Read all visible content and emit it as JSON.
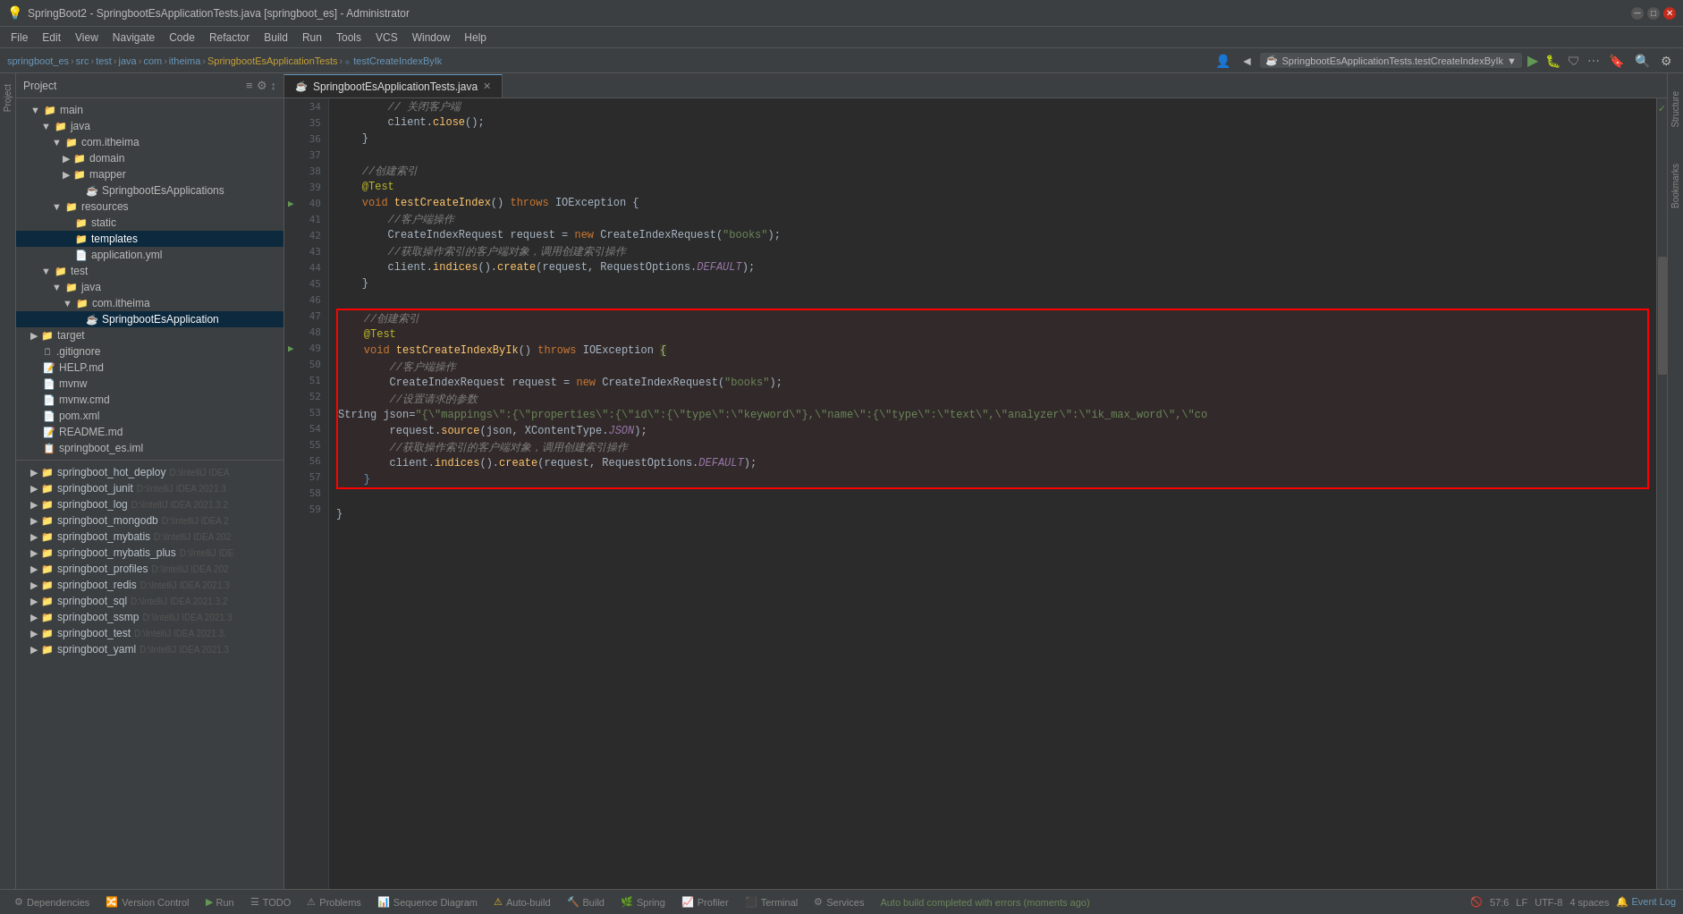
{
  "titleBar": {
    "title": "SpringBoot2 - SpringbootEsApplicationTests.java [springboot_es] - Administrator",
    "minimize": "─",
    "maximize": "□",
    "close": "✕"
  },
  "menuBar": {
    "items": [
      "File",
      "Edit",
      "View",
      "Navigate",
      "Code",
      "Refactor",
      "Build",
      "Run",
      "Tools",
      "VCS",
      "Window",
      "Help"
    ]
  },
  "breadcrumb": {
    "items": [
      "springboot_es",
      "src",
      "test",
      "java",
      "com",
      "itheima",
      "SpringbootEsApplicationTests",
      "testCreateIndexByIk"
    ]
  },
  "runConfig": {
    "label": "SpringbootEsApplicationTests.testCreateIndexByIk"
  },
  "sidebar": {
    "title": "Project",
    "tree": [
      {
        "indent": 2,
        "type": "folder",
        "label": "main",
        "expanded": true
      },
      {
        "indent": 3,
        "type": "folder",
        "label": "java",
        "expanded": true
      },
      {
        "indent": 4,
        "type": "folder",
        "label": "com.itheima",
        "expanded": true
      },
      {
        "indent": 5,
        "type": "folder",
        "label": "domain",
        "collapsed": true
      },
      {
        "indent": 5,
        "type": "folder",
        "label": "mapper",
        "collapsed": true
      },
      {
        "indent": 5,
        "type": "java",
        "label": "SpringbootEsApplications",
        "selected": false
      },
      {
        "indent": 4,
        "type": "folder",
        "label": "resources",
        "expanded": true
      },
      {
        "indent": 5,
        "type": "folder",
        "label": "static",
        "collapsed": true
      },
      {
        "indent": 5,
        "type": "folder-tpl",
        "label": "templates",
        "selected": true
      },
      {
        "indent": 5,
        "type": "yaml",
        "label": "application.yml"
      },
      {
        "indent": 3,
        "type": "folder",
        "label": "test",
        "expanded": true
      },
      {
        "indent": 4,
        "type": "folder",
        "label": "java",
        "expanded": true
      },
      {
        "indent": 5,
        "type": "folder",
        "label": "com.itheima",
        "expanded": true
      },
      {
        "indent": 6,
        "type": "test-java",
        "label": "SpringbootEsApplication",
        "selected": true
      },
      {
        "indent": 2,
        "type": "folder-target",
        "label": "target",
        "collapsed": true
      },
      {
        "indent": 2,
        "type": "gitignore",
        "label": ".gitignore"
      },
      {
        "indent": 2,
        "type": "md",
        "label": "HELP.md"
      },
      {
        "indent": 2,
        "type": "file",
        "label": "mvnw"
      },
      {
        "indent": 2,
        "type": "file",
        "label": "mvnw.cmd"
      },
      {
        "indent": 2,
        "type": "xml",
        "label": "pom.xml"
      },
      {
        "indent": 2,
        "type": "md",
        "label": "README.md"
      },
      {
        "indent": 2,
        "type": "iml",
        "label": "springboot_es.iml"
      }
    ],
    "externalProjects": [
      {
        "label": "springboot_hot_deploy",
        "path": "D:\\IntelliJ IDEA"
      },
      {
        "label": "springboot_junit",
        "path": "D:\\IntelliJ IDEA 2021.3"
      },
      {
        "label": "springboot_log",
        "path": "D:\\IntelliJ IDEA 2021.3.2"
      },
      {
        "label": "springboot_mongodb",
        "path": "D:\\IntelliJ IDEA 2"
      },
      {
        "label": "springboot_mybatis",
        "path": "D:\\IntelliJ IDEA 202"
      },
      {
        "label": "springboot_mybatis_plus",
        "path": "D:\\IntelliJ IDE"
      },
      {
        "label": "springboot_profiles",
        "path": "D:\\IntelliJ IDEA 2021"
      },
      {
        "label": "springboot_redis",
        "path": "D:\\IntelliJ IDEA 2021.3"
      },
      {
        "label": "springboot_sql",
        "path": "D:\\IntelliJ IDEA 2021.3.2"
      },
      {
        "label": "springboot_ssmp",
        "path": "D:\\IntelliJ IDEA 2021.3"
      },
      {
        "label": "springboot_test",
        "path": "D:\\IntelliJ IDEA 2021.3."
      },
      {
        "label": "springboot_yaml",
        "path": "D:\\IntelliJ IDEA 2021.3"
      }
    ]
  },
  "editor": {
    "tab": {
      "name": "SpringbootEsApplicationTests.java",
      "icon": "☕"
    },
    "lines": [
      {
        "num": 34,
        "code": "        // 关闭客户端"
      },
      {
        "num": 35,
        "code": "        client.close();"
      },
      {
        "num": 36,
        "code": "    }"
      },
      {
        "num": 37,
        "code": ""
      },
      {
        "num": 38,
        "code": "    //创建索引"
      },
      {
        "num": 39,
        "code": "    @Test",
        "isAnnotation": true
      },
      {
        "num": 40,
        "code": "    void testCreateIndex() throws IOException {",
        "hasRunIcon": true
      },
      {
        "num": 41,
        "code": "        //客户端操作"
      },
      {
        "num": 42,
        "code": "        CreateIndexRequest request = new CreateIndexRequest(\"books\");"
      },
      {
        "num": 43,
        "code": "        //获取操作索引的客户端对象，调用创建索引操作"
      },
      {
        "num": 44,
        "code": "        client.indices().create(request, RequestOptions.DEFAULT);"
      },
      {
        "num": 45,
        "code": "    }"
      },
      {
        "num": 46,
        "code": ""
      },
      {
        "num": 47,
        "code": "    //创建索引",
        "inBox": true
      },
      {
        "num": 48,
        "code": "    @Test",
        "inBox": true
      },
      {
        "num": 49,
        "code": "    void testCreateIndexByIk() throws IOException {",
        "inBox": true,
        "hasRunIcon": true
      },
      {
        "num": 50,
        "code": "        //客户端操作",
        "inBox": true
      },
      {
        "num": 51,
        "code": "        CreateIndexRequest request = new CreateIndexRequest(\"books\");",
        "inBox": true
      },
      {
        "num": 52,
        "code": "        //设置请求的参数",
        "inBox": true
      },
      {
        "num": 53,
        "code": "        String json=\"{\\\"mappings\\\":{\\\"properties\\\":{\\\"id\\\":{\\\"type\\\":\\\"keyword\\\"},\\\"name\\\":{\\\"type\\\":\\\"text\\\",\\\"analyzer\\\":\\\"ik_max_word\\\",\\\"co",
        "inBox": true
      },
      {
        "num": 54,
        "code": "        request.source(json, XContentType.JSON);",
        "inBox": true
      },
      {
        "num": 55,
        "code": "        //获取操作索引的客户端对象，调用创建索引操作",
        "inBox": true
      },
      {
        "num": 56,
        "code": "        client.indices().create(request, RequestOptions.DEFAULT);",
        "inBox": true
      },
      {
        "num": 57,
        "code": "    }",
        "inBox": true
      },
      {
        "num": 58,
        "code": ""
      },
      {
        "num": 59,
        "code": "}"
      }
    ]
  },
  "statusBar": {
    "tabs": [
      {
        "label": "Dependencies",
        "icon": ""
      },
      {
        "label": "Version Control",
        "icon": ""
      },
      {
        "label": "Run",
        "icon": "▶"
      },
      {
        "label": "TODO",
        "icon": "☰"
      },
      {
        "label": "Problems",
        "icon": ""
      },
      {
        "label": "Sequence Diagram",
        "icon": ""
      },
      {
        "label": "Auto-build",
        "icon": "⚠"
      },
      {
        "label": "Build",
        "icon": "🔨"
      },
      {
        "label": "Spring",
        "icon": "🌿"
      },
      {
        "label": "Profiler",
        "icon": ""
      },
      {
        "label": "Terminal",
        "icon": ""
      },
      {
        "label": "Services",
        "icon": ""
      }
    ],
    "message": "Auto build completed with errors (moments ago)",
    "rightInfo": {
      "position": "57:6",
      "lineEnding": "LF",
      "encoding": "UTF-8",
      "indent": "4 spaces"
    }
  },
  "activityBar": {
    "items": [
      "Project",
      "Structure",
      "Bookmarks"
    ]
  }
}
